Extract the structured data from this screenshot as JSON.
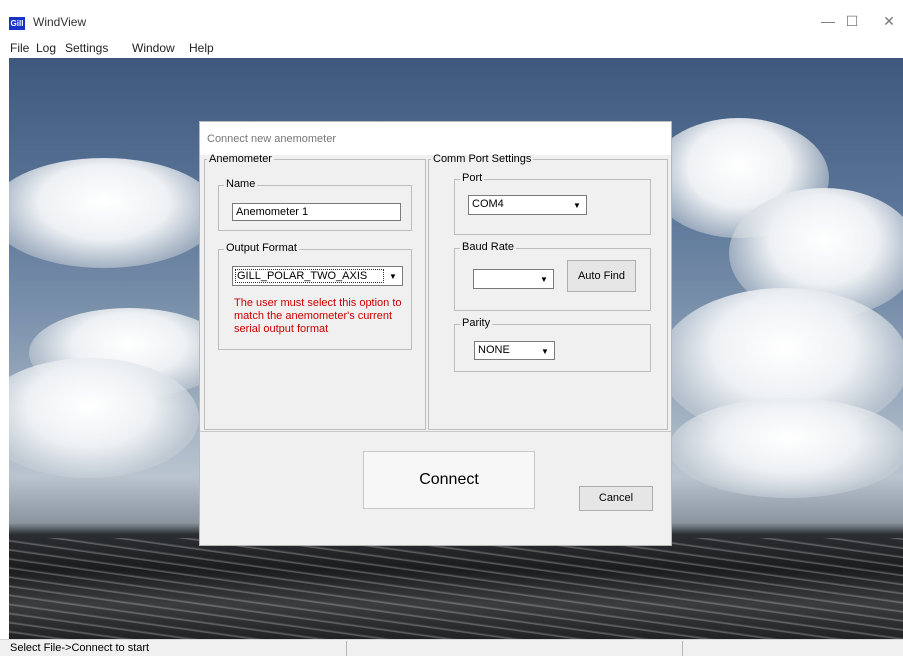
{
  "window": {
    "icon_text": "Gill",
    "title": "WindView",
    "minimize": "—",
    "maximize": "☐",
    "close": "✕"
  },
  "menu": [
    "File",
    "Log",
    "Settings",
    "Window",
    "Help"
  ],
  "dialog": {
    "title": "Connect new anemometer",
    "anemometer_group": "Anemometer",
    "name_label": "Name",
    "name_value": "Anemometer 1",
    "output_format_label": "Output Format",
    "output_format_value": "GILL_POLAR_TWO_AXIS",
    "output_note": [
      "The user must select this option to",
      "match the anemometer's current",
      "serial output format"
    ],
    "comm_group": "Comm Port Settings",
    "port_label": "Port",
    "port_value": "COM4",
    "baud_label": "Baud Rate",
    "baud_value": "",
    "auto_find_label": "Auto Find",
    "parity_label": "Parity",
    "parity_value": "NONE",
    "connect_label": "Connect",
    "cancel_label": "Cancel"
  },
  "status": {
    "text": "Select File->Connect to start"
  },
  "colors": {
    "note_red": "#cc0000",
    "icon_blue": "#1a33c9"
  }
}
